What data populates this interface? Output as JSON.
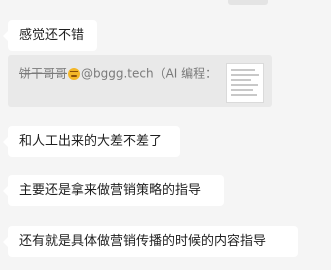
{
  "messages": [
    {
      "text": "感觉还不错"
    },
    {
      "text": "和人工出来的大差不差了"
    },
    {
      "text": "主要还是拿来做营销策略的指导"
    },
    {
      "text": "还有就是具体做营销传播的时候的内容指导"
    }
  ],
  "quote": {
    "sender": "饼干哥哥",
    "after_emoji": "@bggg.tech（AI 编程：",
    "emoji_icon": "sad-face-emoji",
    "thumbnail_icon": "document-thumbnail"
  },
  "colors": {
    "background": "#f5f5f5",
    "bubble": "#ffffff",
    "quote_background": "#e9e9e9",
    "quote_text": "#7a7a7a"
  }
}
